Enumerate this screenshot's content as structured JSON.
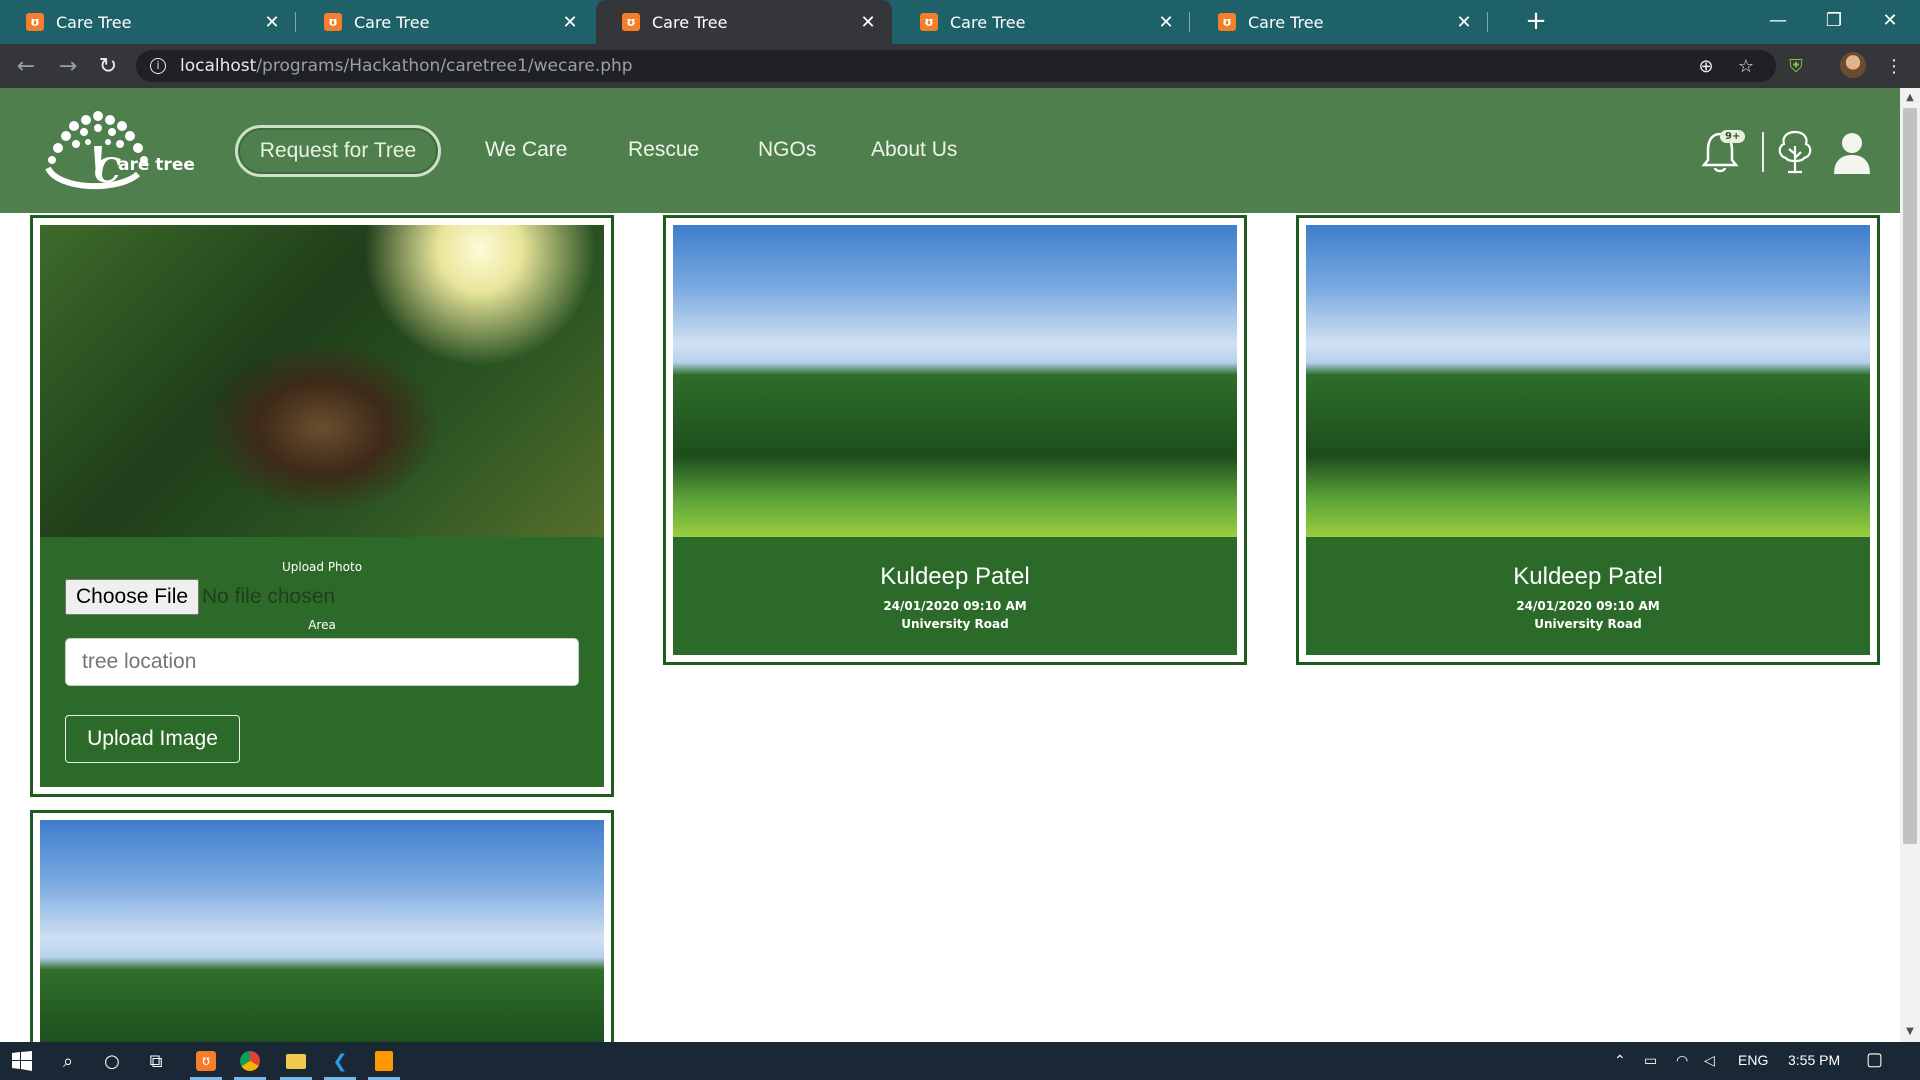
{
  "browser": {
    "tabs": [
      {
        "title": "Care Tree",
        "active": false
      },
      {
        "title": "Care Tree",
        "active": false
      },
      {
        "title": "Care Tree",
        "active": true
      },
      {
        "title": "Care Tree",
        "active": false
      },
      {
        "title": "Care Tree",
        "active": false
      }
    ],
    "favicon": "xampp-icon",
    "url_host": "localhost",
    "url_path": "/programs/Hackathon/caretree1/wecare.php",
    "colors": {
      "tab_strip": "#1e6169",
      "toolbar": "#35363a"
    }
  },
  "site": {
    "logo_text": "Care tree",
    "nav": {
      "request_button": "Request for Tree",
      "links": [
        "We Care",
        "Rescue",
        "NGOs",
        "About Us"
      ]
    },
    "notification_badge": "9+",
    "colors": {
      "header": "#4f7f4c",
      "card": "#2e6b2b",
      "card_border": "#1f5a1f"
    }
  },
  "upload_form": {
    "photo_label": "Upload Photo",
    "file_button": "Choose File",
    "file_status": "No file chosen",
    "area_label": "Area",
    "area_placeholder": "tree location",
    "area_value": "",
    "submit_label": "Upload Image"
  },
  "posts": [
    {
      "name": "Kuldeep Patel",
      "datetime": "24/01/2020 09:10 AM",
      "location": "University Road"
    },
    {
      "name": "Kuldeep Patel",
      "datetime": "24/01/2020 09:10 AM",
      "location": "University Road"
    }
  ],
  "taskbar": {
    "language": "ENG",
    "time": "3:55 PM"
  }
}
